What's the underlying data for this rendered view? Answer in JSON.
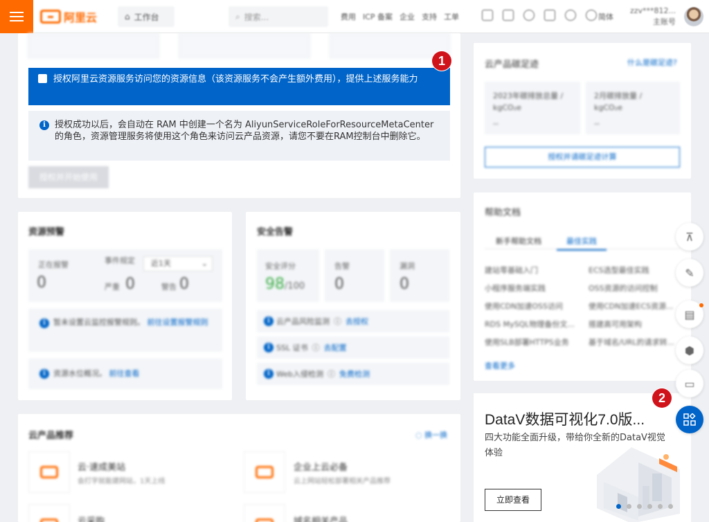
{
  "topbar": {
    "logo_text": "阿里云",
    "workbench": "工作台",
    "search_placeholder": "搜索...",
    "nav_links": [
      "费用",
      "ICP 备案",
      "企业",
      "支持",
      "工单"
    ],
    "language": "简体",
    "account_name": "zzv***812...",
    "account_role": "主账号"
  },
  "auth": {
    "checkbox_text": "授权阿里云资源服务访问您的资源信息（该资源服务不会产生额外费用），提供上述服务能力",
    "info_text": "授权成功以后，会自动在 RAM 中创建一个名为 AliyunServiceRoleForResourceMetaCenter 的角色，资源管理服务将使用这个角色来访问云产品资源，请您不要在RAM控制台中删除它。",
    "button": "授权并开始使用",
    "badge": "1"
  },
  "resource_alert": {
    "title": "资源预警",
    "alerting_label": "正在报警",
    "alerting_value": "0",
    "event_label": "事件规定",
    "period": "近1天",
    "severe_label": "严重",
    "severe_value": "0",
    "warning_label": "警告",
    "warning_value": "0",
    "notice_text": "暂未设置云监控报警规则。",
    "notice_link": "前往设置报警规则",
    "watermark_text": "资源水位概况。",
    "watermark_link": "前往查看"
  },
  "security_alert": {
    "title": "安全告警",
    "score_label": "安全评分",
    "score_value": "98",
    "score_max": "/100",
    "alarm_label": "告警",
    "alarm_value": "0",
    "vuln_label": "漏洞",
    "vuln_value": "0",
    "rows": [
      {
        "label": "云产品风险监测",
        "action": "去授权"
      },
      {
        "label": "SSL 证书",
        "action": "去配置"
      },
      {
        "label": "Web入侵检测",
        "action": "免费检测"
      }
    ]
  },
  "recommend": {
    "title": "云产品推荐",
    "refresh": "换一换",
    "items": [
      {
        "name": "云·速成美站",
        "desc": "会打字就能建网站，1天上线"
      },
      {
        "name": "企业上云必备",
        "desc": "云上网站轻松部署相关产品推荐"
      },
      {
        "name": "云采购",
        "desc": ""
      },
      {
        "name": "域名相关产品",
        "desc": ""
      }
    ]
  },
  "carbon": {
    "title": "云产品碳足迹",
    "link": "什么是碳足迹?",
    "box1_label": "2023年碳排放总量 / kgCO₂e",
    "box1_value": "--",
    "box2_label": "2月碳排放量 / kgCO₂e",
    "box2_value": "--",
    "button": "授权并请碳足迹计算"
  },
  "help": {
    "title": "帮助文档",
    "tabs": [
      "新手帮助文档",
      "最佳实践"
    ],
    "links_left": [
      "建站零基础入门",
      "小程序服务端实践",
      "使用CDN加速OSS访问",
      "RDS MySQL物理备份文...",
      "使用SLB部署HTTPS业务"
    ],
    "links_right": [
      "ECS选型最佳实践",
      "OSS资源的访问控制",
      "使用CDN加速ECS资源...",
      "搭建高可用架构",
      "基于域名/URL的请求转..."
    ],
    "more": "查看更多"
  },
  "promo": {
    "title": "DataV数据可视化7.0版...",
    "desc": "四大功能全面升级，带给你全新的DataV视觉体验",
    "button": "立即查看",
    "badge": "2"
  },
  "side_tools": [
    "top-icon",
    "edit-icon",
    "clipboard-icon",
    "cube-icon",
    "chat-icon",
    "apps-icon"
  ]
}
